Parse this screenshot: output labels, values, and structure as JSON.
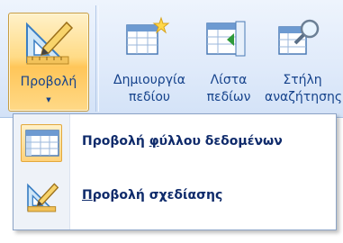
{
  "ribbon": {
    "view_button": {
      "label": "Προβολή",
      "dropdown_glyph": "▼",
      "icon": "design-view-icon"
    },
    "tools": [
      {
        "line1": "Δημιουργία",
        "line2": "πεδίου",
        "icon": "new-field-icon"
      },
      {
        "line1": "Λίστα",
        "line2": "πεδίων",
        "icon": "field-list-icon"
      },
      {
        "line1": "Στήλη",
        "line2": "αναζήτησης",
        "icon": "lookup-column-icon"
      }
    ]
  },
  "menu": {
    "items": [
      {
        "label_prefix": "Προβολή ",
        "label_accel": "φ",
        "label_rest": "ύλλου δεδομένων",
        "icon": "datasheet-view-icon",
        "selected": true
      },
      {
        "label_prefix": "",
        "label_accel": "Π",
        "label_rest": "ροβολή σχεδίασης",
        "icon": "design-view-icon",
        "selected": false
      }
    ]
  },
  "colors": {
    "accent_text": "#15428b",
    "hover_fill": "#ffd27a",
    "ribbon_bg": "#dfeafa"
  }
}
